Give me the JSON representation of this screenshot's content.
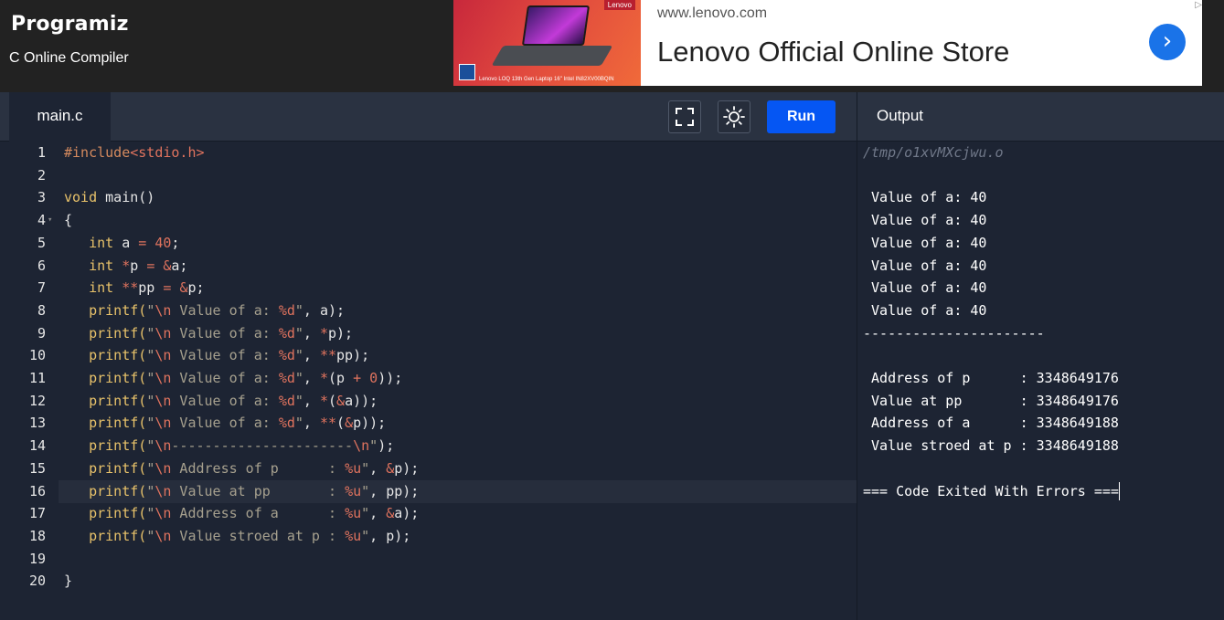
{
  "header": {
    "logo_text": "Programiz",
    "subtitle": "C Online Compiler"
  },
  "ad": {
    "image_tag": "Lenovo",
    "image_caption": "Lenovo LOQ 13th Gen Laptop 16\" Intel IN82XV00BQIN",
    "url": "www.lenovo.com",
    "headline": "Lenovo Official Online Store",
    "arrow_icon": "chevron-right-icon",
    "choices_icon": "ad-choices-icon"
  },
  "editor": {
    "tab_label": "main.c",
    "run_label": "Run",
    "fullscreen_icon": "fullscreen-icon",
    "theme_icon": "sun-icon",
    "line_numbers": [
      "1",
      "2",
      "3",
      "4",
      "5",
      "6",
      "7",
      "8",
      "9",
      "10",
      "11",
      "12",
      "13",
      "14",
      "15",
      "16",
      "17",
      "18",
      "19",
      "20"
    ],
    "active_line": 16,
    "lines": [
      [
        {
          "t": "#include",
          "c": "pre"
        },
        {
          "t": "<stdio.h>",
          "c": "inc"
        }
      ],
      [],
      [
        {
          "t": "void",
          "c": "kw"
        },
        {
          "t": " main()",
          "c": "def"
        }
      ],
      [
        {
          "t": "{",
          "c": "def"
        }
      ],
      [
        {
          "t": "   ",
          "c": "def"
        },
        {
          "t": "int",
          "c": "kw"
        },
        {
          "t": " a ",
          "c": "def"
        },
        {
          "t": "=",
          "c": "op"
        },
        {
          "t": " ",
          "c": "def"
        },
        {
          "t": "40",
          "c": "num"
        },
        {
          "t": ";",
          "c": "def"
        }
      ],
      [
        {
          "t": "   ",
          "c": "def"
        },
        {
          "t": "int",
          "c": "kw"
        },
        {
          "t": " ",
          "c": "def"
        },
        {
          "t": "*",
          "c": "op"
        },
        {
          "t": "p ",
          "c": "def"
        },
        {
          "t": "=",
          "c": "op"
        },
        {
          "t": " ",
          "c": "def"
        },
        {
          "t": "&",
          "c": "op"
        },
        {
          "t": "a;",
          "c": "def"
        }
      ],
      [
        {
          "t": "   ",
          "c": "def"
        },
        {
          "t": "int",
          "c": "kw"
        },
        {
          "t": " ",
          "c": "def"
        },
        {
          "t": "**",
          "c": "op"
        },
        {
          "t": "pp ",
          "c": "def"
        },
        {
          "t": "=",
          "c": "op"
        },
        {
          "t": " ",
          "c": "def"
        },
        {
          "t": "&",
          "c": "op"
        },
        {
          "t": "p;",
          "c": "def"
        }
      ],
      [
        {
          "t": "   printf(",
          "c": "kw"
        },
        {
          "t": "\"",
          "c": "str"
        },
        {
          "t": "\\n",
          "c": "esc"
        },
        {
          "t": " Value of a: ",
          "c": "str"
        },
        {
          "t": "%d",
          "c": "esc"
        },
        {
          "t": "\"",
          "c": "str"
        },
        {
          "t": ", a);",
          "c": "def"
        }
      ],
      [
        {
          "t": "   printf(",
          "c": "kw"
        },
        {
          "t": "\"",
          "c": "str"
        },
        {
          "t": "\\n",
          "c": "esc"
        },
        {
          "t": " Value of a: ",
          "c": "str"
        },
        {
          "t": "%d",
          "c": "esc"
        },
        {
          "t": "\"",
          "c": "str"
        },
        {
          "t": ", ",
          "c": "def"
        },
        {
          "t": "*",
          "c": "op"
        },
        {
          "t": "p);",
          "c": "def"
        }
      ],
      [
        {
          "t": "   printf(",
          "c": "kw"
        },
        {
          "t": "\"",
          "c": "str"
        },
        {
          "t": "\\n",
          "c": "esc"
        },
        {
          "t": " Value of a: ",
          "c": "str"
        },
        {
          "t": "%d",
          "c": "esc"
        },
        {
          "t": "\"",
          "c": "str"
        },
        {
          "t": ", ",
          "c": "def"
        },
        {
          "t": "**",
          "c": "op"
        },
        {
          "t": "pp);",
          "c": "def"
        }
      ],
      [
        {
          "t": "   printf(",
          "c": "kw"
        },
        {
          "t": "\"",
          "c": "str"
        },
        {
          "t": "\\n",
          "c": "esc"
        },
        {
          "t": " Value of a: ",
          "c": "str"
        },
        {
          "t": "%d",
          "c": "esc"
        },
        {
          "t": "\"",
          "c": "str"
        },
        {
          "t": ", ",
          "c": "def"
        },
        {
          "t": "*",
          "c": "op"
        },
        {
          "t": "(p ",
          "c": "def"
        },
        {
          "t": "+",
          "c": "op"
        },
        {
          "t": " ",
          "c": "def"
        },
        {
          "t": "0",
          "c": "num"
        },
        {
          "t": "));",
          "c": "def"
        }
      ],
      [
        {
          "t": "   printf(",
          "c": "kw"
        },
        {
          "t": "\"",
          "c": "str"
        },
        {
          "t": "\\n",
          "c": "esc"
        },
        {
          "t": " Value of a: ",
          "c": "str"
        },
        {
          "t": "%d",
          "c": "esc"
        },
        {
          "t": "\"",
          "c": "str"
        },
        {
          "t": ", ",
          "c": "def"
        },
        {
          "t": "*",
          "c": "op"
        },
        {
          "t": "(",
          "c": "def"
        },
        {
          "t": "&",
          "c": "op"
        },
        {
          "t": "a));",
          "c": "def"
        }
      ],
      [
        {
          "t": "   printf(",
          "c": "kw"
        },
        {
          "t": "\"",
          "c": "str"
        },
        {
          "t": "\\n",
          "c": "esc"
        },
        {
          "t": " Value of a: ",
          "c": "str"
        },
        {
          "t": "%d",
          "c": "esc"
        },
        {
          "t": "\"",
          "c": "str"
        },
        {
          "t": ", ",
          "c": "def"
        },
        {
          "t": "**",
          "c": "op"
        },
        {
          "t": "(",
          "c": "def"
        },
        {
          "t": "&",
          "c": "op"
        },
        {
          "t": "p));",
          "c": "def"
        }
      ],
      [
        {
          "t": "   printf(",
          "c": "kw"
        },
        {
          "t": "\"",
          "c": "str"
        },
        {
          "t": "\\n",
          "c": "esc"
        },
        {
          "t": "----------------------",
          "c": "str"
        },
        {
          "t": "\\n",
          "c": "esc"
        },
        {
          "t": "\"",
          "c": "str"
        },
        {
          "t": ");",
          "c": "def"
        }
      ],
      [
        {
          "t": "   printf(",
          "c": "kw"
        },
        {
          "t": "\"",
          "c": "str"
        },
        {
          "t": "\\n",
          "c": "esc"
        },
        {
          "t": " Address of p      : ",
          "c": "str"
        },
        {
          "t": "%u",
          "c": "esc"
        },
        {
          "t": "\"",
          "c": "str"
        },
        {
          "t": ", ",
          "c": "def"
        },
        {
          "t": "&",
          "c": "op"
        },
        {
          "t": "p);",
          "c": "def"
        }
      ],
      [
        {
          "t": "   printf(",
          "c": "kw"
        },
        {
          "t": "\"",
          "c": "str"
        },
        {
          "t": "\\n",
          "c": "esc"
        },
        {
          "t": " Value at pp       : ",
          "c": "str"
        },
        {
          "t": "%u",
          "c": "esc"
        },
        {
          "t": "\"",
          "c": "str"
        },
        {
          "t": ", pp);",
          "c": "def"
        }
      ],
      [
        {
          "t": "   printf(",
          "c": "kw"
        },
        {
          "t": "\"",
          "c": "str"
        },
        {
          "t": "\\n",
          "c": "esc"
        },
        {
          "t": " Address of a      : ",
          "c": "str"
        },
        {
          "t": "%u",
          "c": "esc"
        },
        {
          "t": "\"",
          "c": "str"
        },
        {
          "t": ", ",
          "c": "def"
        },
        {
          "t": "&",
          "c": "op"
        },
        {
          "t": "a);",
          "c": "def"
        }
      ],
      [
        {
          "t": "   printf(",
          "c": "kw"
        },
        {
          "t": "\"",
          "c": "str"
        },
        {
          "t": "\\n",
          "c": "esc"
        },
        {
          "t": " Value stroed at p : ",
          "c": "str"
        },
        {
          "t": "%u",
          "c": "esc"
        },
        {
          "t": "\"",
          "c": "str"
        },
        {
          "t": ", p);",
          "c": "def"
        }
      ],
      [],
      [
        {
          "t": "}",
          "c": "def"
        }
      ]
    ]
  },
  "output": {
    "title": "Output",
    "path": "/tmp/o1xvMXcjwu.o",
    "lines": [
      {
        "row": 2,
        "text": " Value of a: 40"
      },
      {
        "row": 3,
        "text": " Value of a: 40"
      },
      {
        "row": 4,
        "text": " Value of a: 40"
      },
      {
        "row": 5,
        "text": " Value of a: 40"
      },
      {
        "row": 6,
        "text": " Value of a: 40"
      },
      {
        "row": 7,
        "text": " Value of a: 40"
      },
      {
        "row": 8,
        "text": "----------------------"
      },
      {
        "row": 10,
        "text": " Address of p      : 3348649176"
      },
      {
        "row": 11,
        "text": " Value at pp       : 3348649176"
      },
      {
        "row": 12,
        "text": " Address of a      : 3348649188"
      },
      {
        "row": 13,
        "text": " Value stroed at p : 3348649188"
      },
      {
        "row": 15,
        "text": "=== Code Exited With Errors ==="
      }
    ]
  }
}
